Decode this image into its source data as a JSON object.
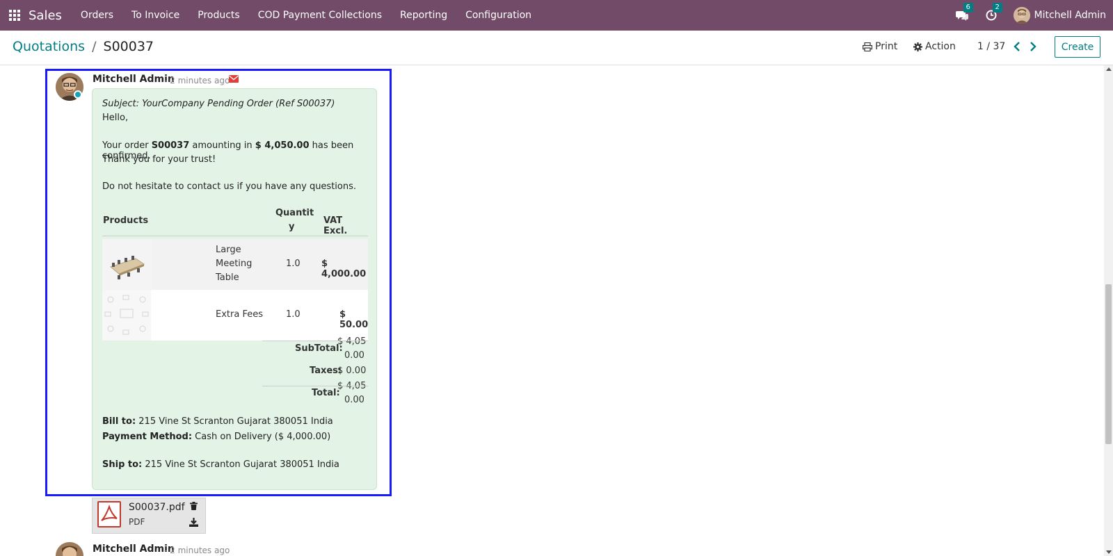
{
  "navbar": {
    "app_name": "Sales",
    "menu": [
      "Orders",
      "To Invoice",
      "Products",
      "COD Payment Collections",
      "Reporting",
      "Configuration"
    ],
    "messages_count": "6",
    "activities_count": "2",
    "user_name": "Mitchell Admin",
    "bg_color": "#714b67"
  },
  "breadcrumb": {
    "parent": "Quotations",
    "separator": "/",
    "current": "S00037"
  },
  "toolbar": {
    "print_label": "Print",
    "action_label": "Action",
    "pager": "1 / 37",
    "create_label": "Create"
  },
  "message": {
    "author": "Mitchell Admin",
    "time": "- 2 minutes ago",
    "subject": "Subject: YourCompany Pending Order (Ref S00037)",
    "greeting": "Hello,",
    "line1_a": "Your order ",
    "line1_order": "S00037",
    "line1_b": " amounting in ",
    "line1_amount": "$ 4,050.00",
    "line1_c": " has been confirmed.",
    "line2": "Thank you for your trust!",
    "line3": "Do not hesitate to contact us if you have any questions.",
    "table": {
      "col_products": "Products",
      "col_qty_1": "Quantit",
      "col_qty_2": "y",
      "col_vat": "VAT Excl.",
      "rows": [
        {
          "name_1": "Large",
          "name_2": "Meeting",
          "name_3": "Table",
          "qty": "1.0",
          "price": "$ 4,000.00"
        },
        {
          "name_1": "Extra Fees",
          "qty": "1.0",
          "price": "$ 50.00"
        }
      ]
    },
    "totals": {
      "subtotal_label": "SubTotal:",
      "subtotal_1": "$ 4,05",
      "subtotal_2": "0.00",
      "taxes_label": "Taxes:",
      "taxes": "$ 0.00",
      "total_label": "Total:",
      "total_1": "$ 4,05",
      "total_2": "0.00"
    },
    "bill_label": "Bill to:",
    "bill_value": " 215 Vine St Scranton Gujarat 380051 India",
    "payment_label": "Payment Method:",
    "payment_value": " Cash on Delivery ($ 4,000.00)",
    "ship_label": "Ship to:",
    "ship_value": " 215 Vine St Scranton Gujarat 380051 India"
  },
  "attachment": {
    "filename": "S00037.pdf",
    "type": "PDF"
  },
  "next_message": {
    "author": "Mitchell Admin",
    "time": "- 2 minutes ago"
  }
}
